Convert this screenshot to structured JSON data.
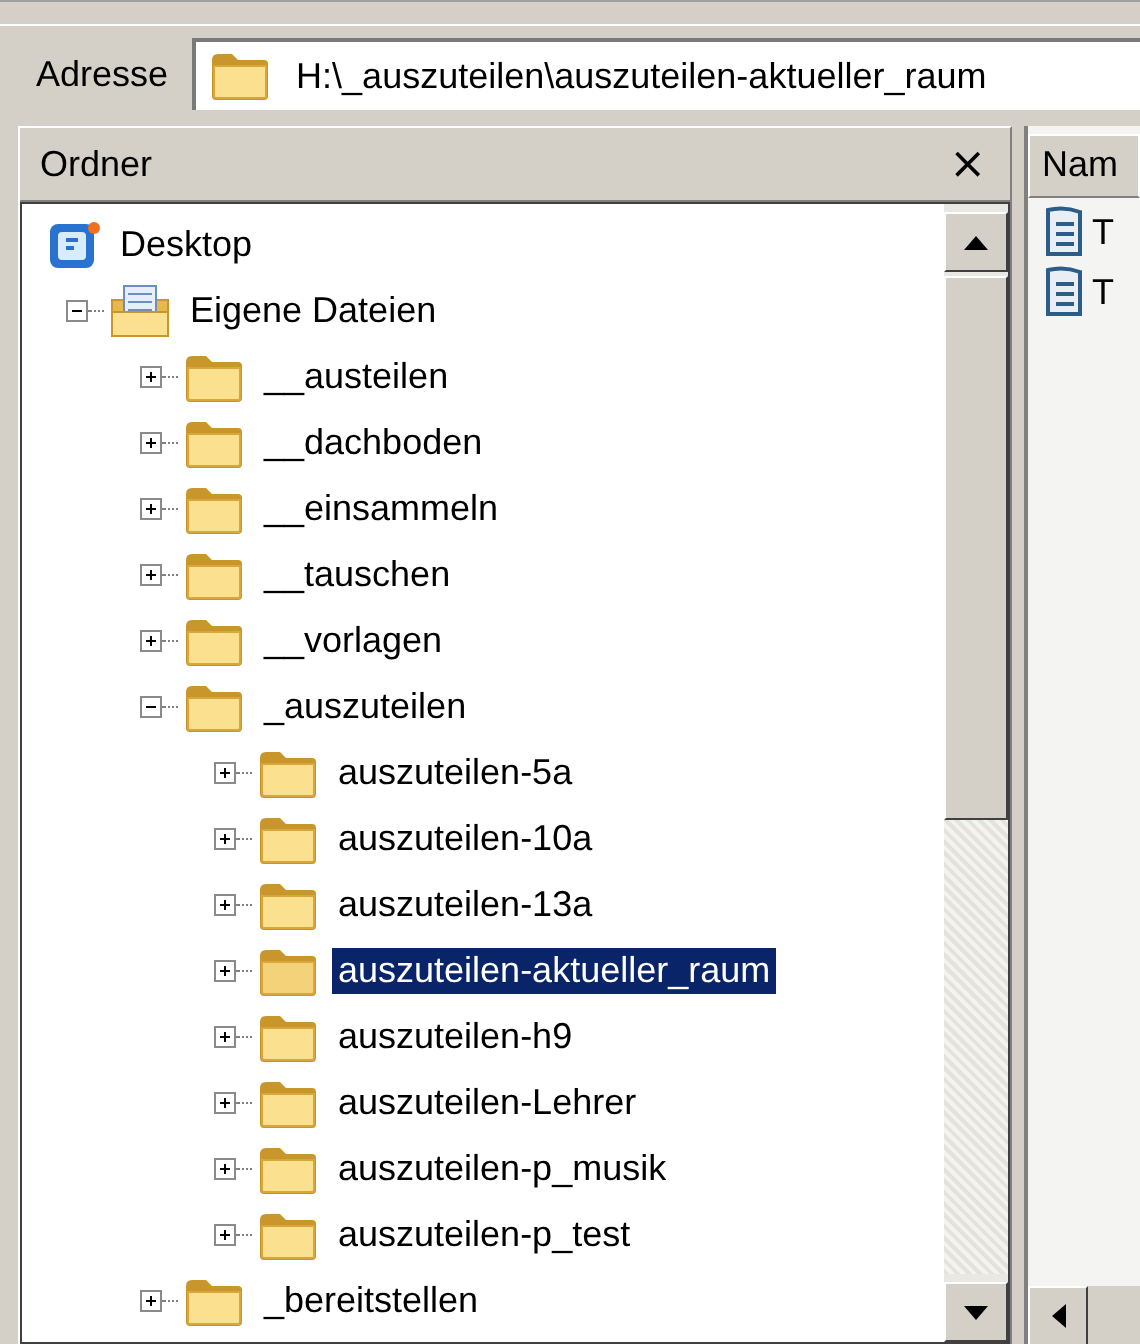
{
  "address_bar": {
    "label": "Adresse",
    "value": "H:\\_auszuteilen\\auszuteilen-aktueller_raum"
  },
  "folders_pane": {
    "title": "Ordner",
    "close": "×",
    "tree": [
      {
        "label": "Desktop",
        "kind": "desktop",
        "selected": false,
        "children": [
          {
            "label": "Eigene Dateien",
            "kind": "documents",
            "expanded": true,
            "selected": false,
            "children": [
              {
                "label": "__austeilen",
                "kind": "folder",
                "expanded": false,
                "selected": false
              },
              {
                "label": "__dachboden",
                "kind": "folder",
                "expanded": false,
                "selected": false
              },
              {
                "label": "__einsammeln",
                "kind": "folder",
                "expanded": false,
                "selected": false
              },
              {
                "label": "__tauschen",
                "kind": "folder",
                "expanded": false,
                "selected": false
              },
              {
                "label": "__vorlagen",
                "kind": "folder",
                "expanded": false,
                "selected": false
              },
              {
                "label": "_auszuteilen",
                "kind": "folder",
                "expanded": true,
                "selected": false,
                "children": [
                  {
                    "label": "auszuteilen-5a",
                    "kind": "folder",
                    "expanded": false,
                    "selected": false
                  },
                  {
                    "label": "auszuteilen-10a",
                    "kind": "folder",
                    "expanded": false,
                    "selected": false
                  },
                  {
                    "label": "auszuteilen-13a",
                    "kind": "folder",
                    "expanded": false,
                    "selected": false
                  },
                  {
                    "label": "auszuteilen-aktueller_raum",
                    "kind": "folder",
                    "expanded": false,
                    "selected": true
                  },
                  {
                    "label": "auszuteilen-h9",
                    "kind": "folder",
                    "expanded": false,
                    "selected": false
                  },
                  {
                    "label": "auszuteilen-Lehrer",
                    "kind": "folder",
                    "expanded": false,
                    "selected": false
                  },
                  {
                    "label": "auszuteilen-p_musik",
                    "kind": "folder",
                    "expanded": false,
                    "selected": false
                  },
                  {
                    "label": "auszuteilen-p_test",
                    "kind": "folder",
                    "expanded": false,
                    "selected": false
                  }
                ]
              },
              {
                "label": "_bereitstellen",
                "kind": "folder",
                "expanded": false,
                "selected": false
              }
            ]
          }
        ]
      }
    ]
  },
  "file_list": {
    "columns": [
      "Nam"
    ],
    "items": [
      {
        "label": "T"
      },
      {
        "label": "T"
      }
    ]
  }
}
